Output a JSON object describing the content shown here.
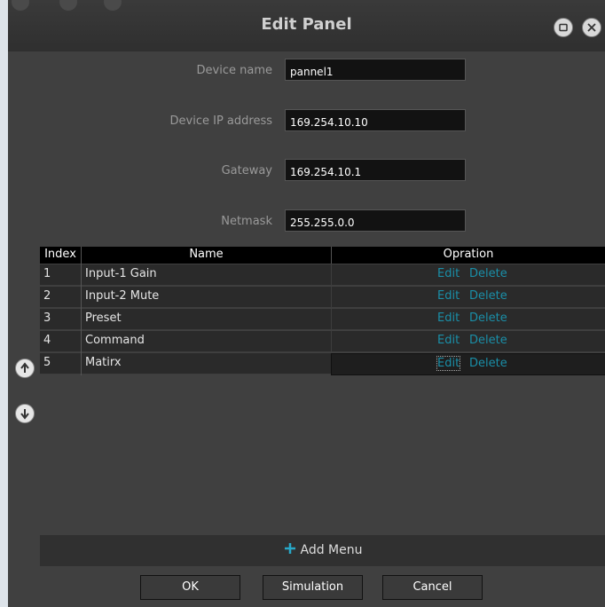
{
  "window": {
    "title": "Edit Panel"
  },
  "fields": [
    {
      "label": "Device name",
      "value": "pannel1"
    },
    {
      "label": "Device IP address",
      "value": "169.254.10.10"
    },
    {
      "label": "Gateway",
      "value": "169.254.10.1"
    },
    {
      "label": "Netmask",
      "value": "255.255.0.0"
    }
  ],
  "table": {
    "headers": {
      "index": "Index",
      "name": "Name",
      "operation": "Opration"
    },
    "rows": [
      {
        "index": "1",
        "name": "Input-1 Gain",
        "edit": "Edit",
        "delete": "Delete"
      },
      {
        "index": "2",
        "name": "Input-2 Mute",
        "edit": "Edit",
        "delete": "Delete"
      },
      {
        "index": "3",
        "name": "Preset",
        "edit": "Edit",
        "delete": "Delete"
      },
      {
        "index": "4",
        "name": "Command",
        "edit": "Edit",
        "delete": "Delete"
      },
      {
        "index": "5",
        "name": "Matirx",
        "edit": "Edit",
        "delete": "Delete"
      }
    ],
    "add_menu": {
      "icon": "plus-icon",
      "label": "Add Menu"
    }
  },
  "side_buttons": {
    "up_icon": "arrow-up-icon",
    "down_icon": "arrow-down-icon"
  },
  "buttons": {
    "ok": "OK",
    "simulation": "Simulation",
    "cancel": "Cancel"
  },
  "colors": {
    "link": "#1a8fa8",
    "accent": "#28a8c8"
  }
}
